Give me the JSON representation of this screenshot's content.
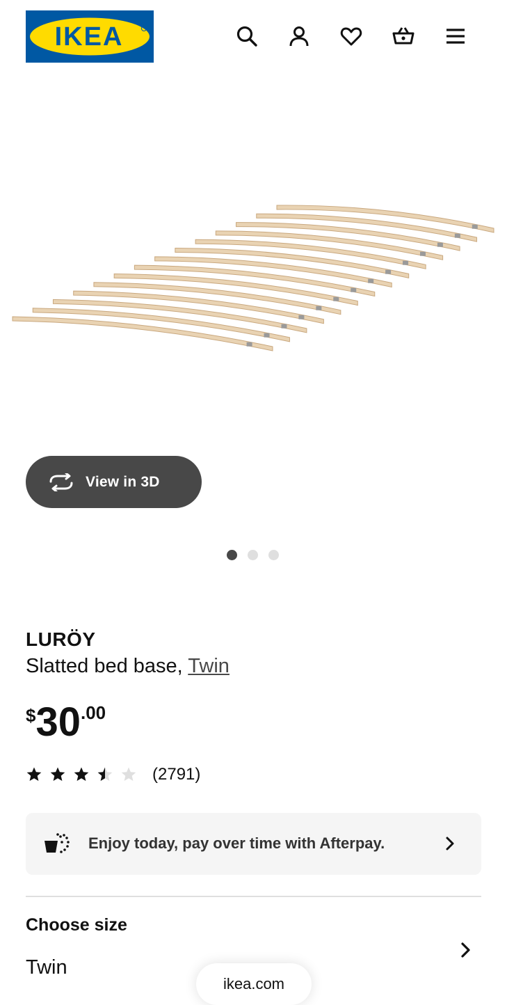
{
  "header": {
    "logo_text": "IKEA",
    "icons": [
      "search-icon",
      "account-icon",
      "heart-icon",
      "basket-icon",
      "menu-icon"
    ]
  },
  "gallery": {
    "view_3d_label": "View in 3D",
    "pages": 3,
    "active_page": 1
  },
  "product": {
    "name": "LURÖY",
    "description": "Slatted bed base,",
    "size_link": "Twin",
    "price": {
      "currency": "$",
      "whole": "30",
      "cents": ".00"
    },
    "rating": {
      "stars": 3.5,
      "max": 5,
      "count": "(2791)"
    }
  },
  "afterpay": {
    "text": "Enjoy today, pay over time with Afterpay."
  },
  "size_selector": {
    "title": "Choose size",
    "value": "Twin"
  },
  "browser": {
    "url": "ikea.com"
  },
  "colors": {
    "ikea_blue": "#0058a3",
    "ikea_yellow": "#ffdb00",
    "dark_gray": "#484848",
    "light_bg": "#f5f5f5"
  }
}
